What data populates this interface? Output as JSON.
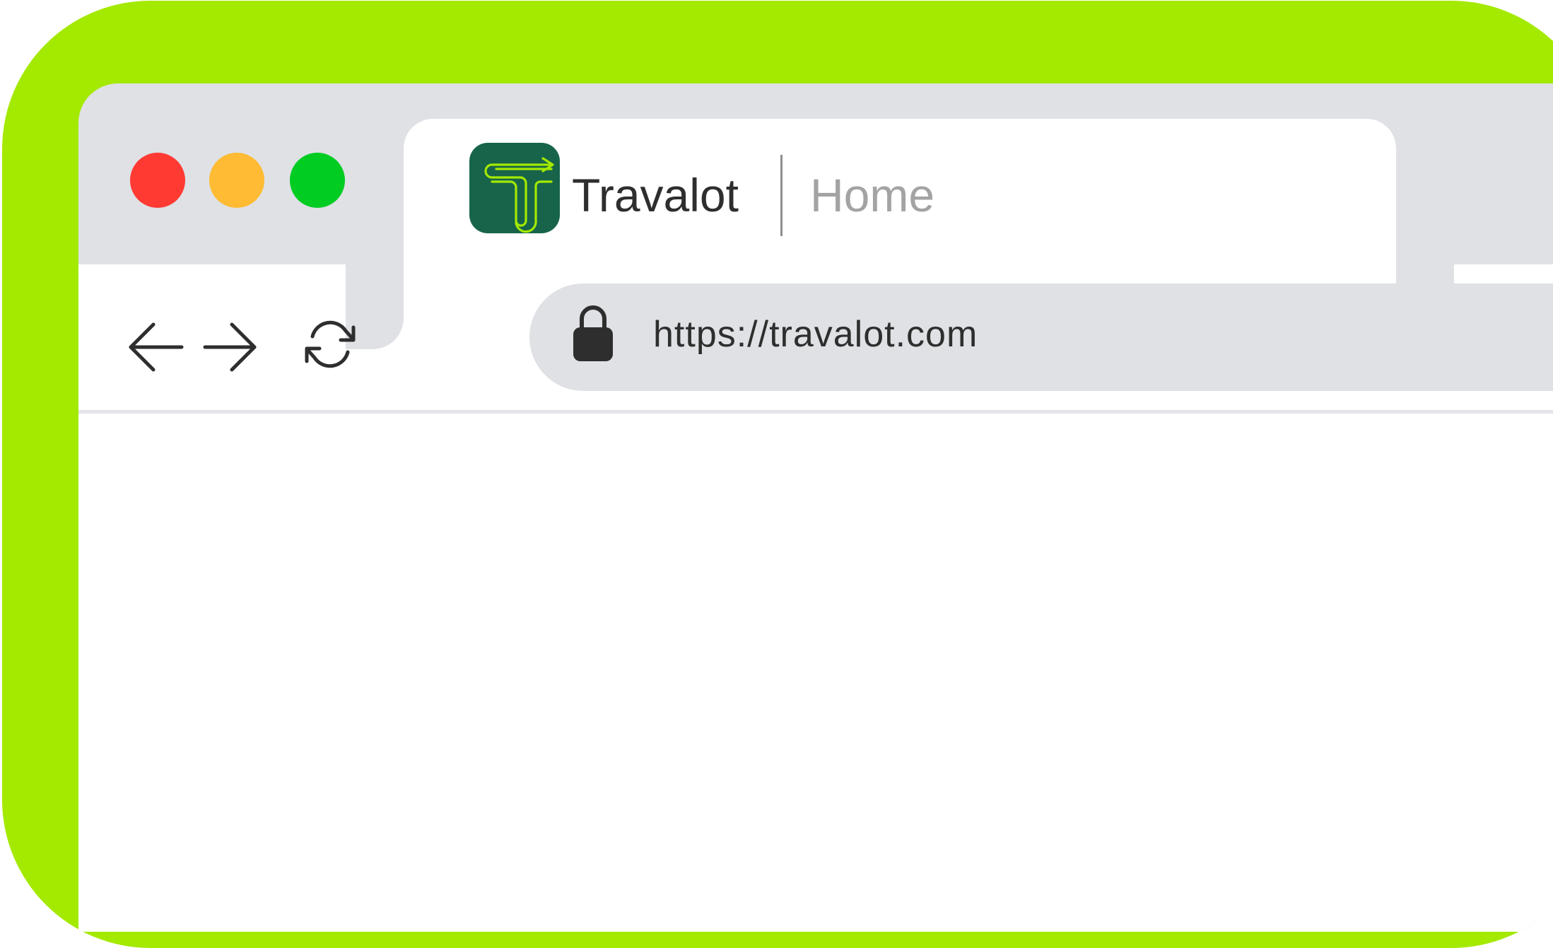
{
  "window": {
    "traffic_lights": {
      "close_color": "#ff3a33",
      "minimize_color": "#ffbb33",
      "maximize_color": "#00cc22"
    }
  },
  "tab": {
    "site_name": "Travalot",
    "page_title": "Home",
    "logo_icon": "travalot-t-logo",
    "logo_bg_color": "#17644b",
    "logo_line_color": "#a4e900"
  },
  "toolbar": {
    "back_icon": "arrow-left-icon",
    "forward_icon": "arrow-right-icon",
    "reload_icon": "reload-icon"
  },
  "address_bar": {
    "lock_icon": "lock-icon",
    "url": "https://travalot.com"
  },
  "colors": {
    "frame_accent": "#a4e900",
    "chrome_gray": "#dfe1e5",
    "content_bg": "#ffffff"
  }
}
